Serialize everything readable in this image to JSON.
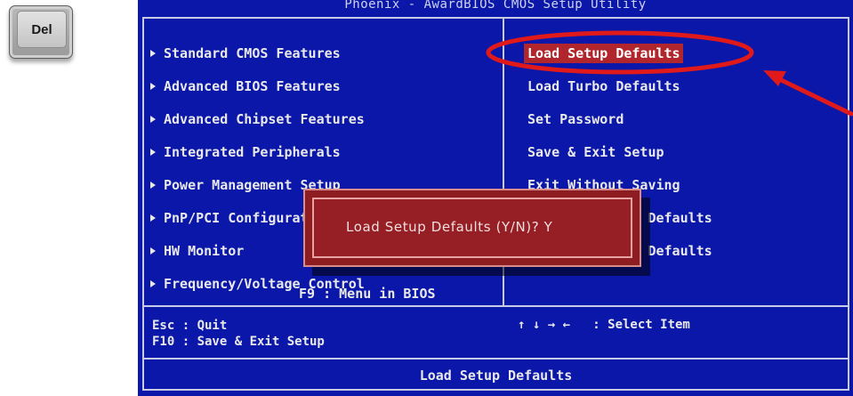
{
  "del_key": {
    "label": "Del"
  },
  "bios": {
    "title": "Phoenix - AwardBIOS CMOS Setup Utility",
    "left_menu": [
      "Standard CMOS Features",
      "Advanced BIOS Features",
      "Advanced Chipset Features",
      "Integrated Peripherals",
      "Power Management Setup",
      "PnP/PCI Configurations",
      "HW Monitor",
      "Frequency/Voltage Control"
    ],
    "right_menu": [
      "Load Setup Defaults",
      "Load Turbo Defaults",
      "Set Password",
      "Save & Exit Setup",
      "Exit Without Saving",
      "Load Fail-Safe Defaults",
      "Load Optimized Defaults"
    ],
    "selected_item": "Load Setup Defaults",
    "dialog": {
      "prompt": "Load Setup Defaults (Y/N)? Y"
    },
    "menu_hint": "F9 : Menu in BIOS",
    "help_left": "Esc : Quit\nF10 : Save & Exit Setup",
    "help_right": "↑ ↓ → ←   : Select Item",
    "status_bar": "Load Setup Defaults"
  },
  "colors": {
    "bios_blue": "#0b17a8",
    "highlight": "#b0262c",
    "dialog_red": "#951f24",
    "annotation_red": "#e01a1a"
  },
  "icons": [
    "arrow-right-icon",
    "annotation-arrow-icon",
    "annotation-circle-icon"
  ]
}
